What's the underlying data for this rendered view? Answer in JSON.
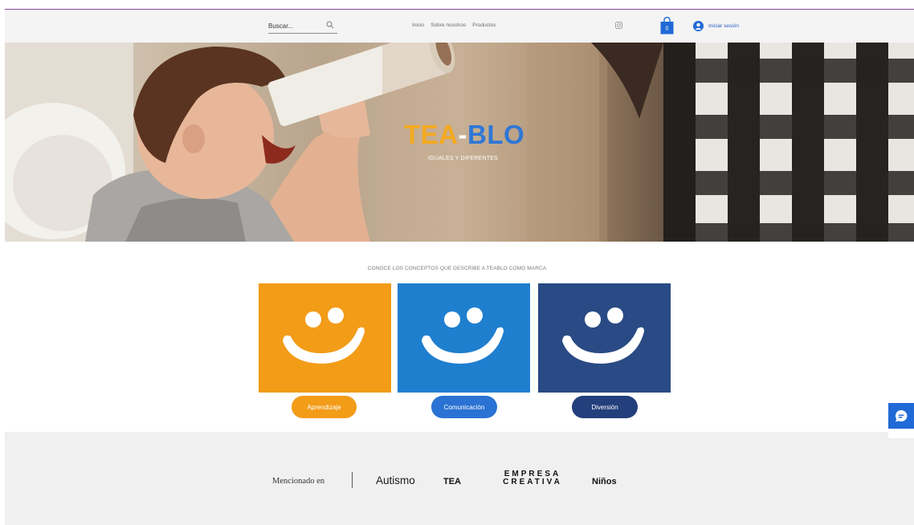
{
  "header": {
    "search": {
      "placeholder": "Buscar..."
    },
    "nav": [
      "Inicio",
      "Sobre nosotros",
      "Productos"
    ],
    "cart_count": "0",
    "login_label": "Iniciar sesión"
  },
  "hero": {
    "title_part1": "TEA",
    "title_dash": "-",
    "title_part2": "BLO",
    "subtitle": "IGUALES Y DIFERENTES"
  },
  "concepts": {
    "heading": "CONOCE LOS CONCEPTOS QUE DESCRIBE A TEABLO COMO MARCA",
    "cards": [
      {
        "label": "Aprendizaje",
        "color": "#f29c18"
      },
      {
        "label": "Comunicación",
        "color": "#1f7fcf"
      },
      {
        "label": "Diversión",
        "color": "#294a84"
      }
    ]
  },
  "footer": {
    "mention_label": "Mencionado en",
    "mentions": [
      "Autismo",
      "TEA",
      "EMPRESA",
      "CREATIVA",
      "Niños"
    ]
  },
  "colors": {
    "accent_orange": "#f29c18",
    "accent_blue": "#2f77d6",
    "accent_navy": "#294a84",
    "chat_blue": "#1f6ad6"
  },
  "icons": [
    "search-icon",
    "instagram-icon",
    "cart-icon",
    "avatar-icon",
    "chat-icon",
    "smiley-icon"
  ]
}
